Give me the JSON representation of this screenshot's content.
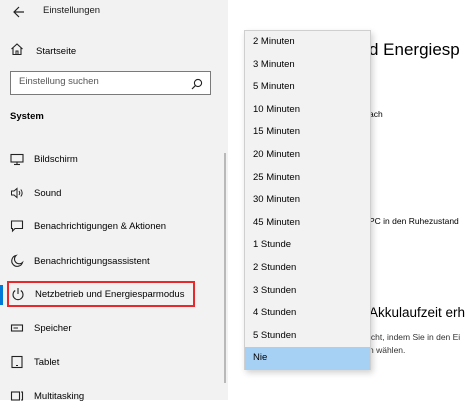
{
  "window": {
    "title": "Einstellungen"
  },
  "sidebar": {
    "home_label": "Startseite",
    "search": {
      "placeholder": "Einstellung suchen"
    },
    "section_label": "System",
    "items": [
      {
        "label": "Bildschirm",
        "icon": "monitor-icon"
      },
      {
        "label": "Sound",
        "icon": "speaker-icon"
      },
      {
        "label": "Benachrichtigungen & Aktionen",
        "icon": "notification-icon"
      },
      {
        "label": "Benachrichtigungsassistent",
        "icon": "moon-icon"
      },
      {
        "label": "Netzbetrieb und Energiesparmodus",
        "icon": "power-icon",
        "selected": true
      },
      {
        "label": "Speicher",
        "icon": "storage-icon"
      },
      {
        "label": "Tablet",
        "icon": "tablet-icon"
      },
      {
        "label": "Multitasking",
        "icon": "multitasking-icon"
      }
    ]
  },
  "content": {
    "heading": "d Energiesp",
    "line1": "ach",
    "line2": "PC in den Ruhezustand",
    "subheading": "Akkulaufzeit erh",
    "line3": "icht, indem Sie in den Ei",
    "line4": "n wählen."
  },
  "dropdown": {
    "options": [
      "2 Minuten",
      "3 Minuten",
      "5 Minuten",
      "10 Minuten",
      "15 Minuten",
      "20 Minuten",
      "25 Minuten",
      "30 Minuten",
      "45 Minuten",
      "1 Stunde",
      "2 Stunden",
      "3 Stunden",
      "4 Stunden",
      "5 Stunden",
      "Nie"
    ],
    "selected": "Nie"
  },
  "colors": {
    "accent": "#0078d7",
    "highlight_border": "#e8282b",
    "selected_option": "#a6d1f5"
  }
}
